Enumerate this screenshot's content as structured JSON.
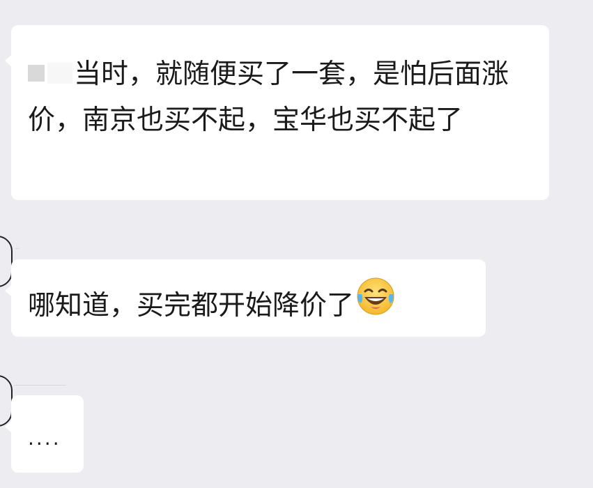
{
  "conversation": {
    "messages": [
      {
        "text": "当时，就随便买了一套，是怕后面涨价，南京也买不起，宝华也买不起了",
        "redacted_prefix": true
      },
      {
        "text": "哪知道，买完都开始降价了",
        "emoji": "laughing-tears-icon"
      },
      {
        "text": "...."
      }
    ]
  },
  "colors": {
    "background": "#edecf1",
    "bubble": "#ffffff",
    "text": "#1a1a1a",
    "emoji_face": "#f7c33b"
  }
}
